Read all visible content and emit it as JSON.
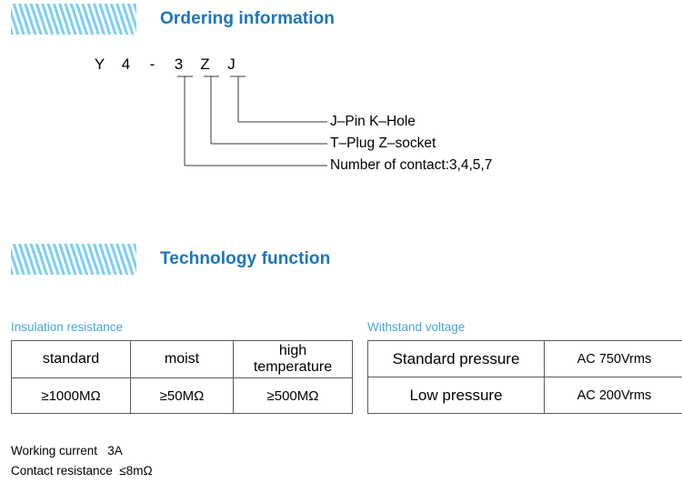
{
  "colors": {
    "heading_blue": "#1b75bc",
    "caption_blue": "#4aa3d8",
    "stripe_blue": "#7ecef4",
    "table_border": "#5a5a5a"
  },
  "sections": {
    "ordering": {
      "title": "Ordering information"
    },
    "technology": {
      "title": "Technology function"
    }
  },
  "ordering_code": {
    "characters": [
      "Y",
      "4",
      "-",
      "3",
      "Z",
      "J"
    ],
    "callouts": [
      {
        "label": "J–Pin  K–Hole"
      },
      {
        "label": "T–Plug  Z–socket"
      },
      {
        "label": "Number of contact:3,4,5,7"
      }
    ]
  },
  "insulation_resistance": {
    "caption": "Insulation resistance",
    "headers": [
      "standard",
      "moist",
      "high\ntemperature"
    ],
    "header_high_line1": "high",
    "header_high_line2": "temperature",
    "values": [
      "≥1000MΩ",
      "≥50MΩ",
      "≥500MΩ"
    ]
  },
  "withstand_voltage": {
    "caption": "Withstand voltage",
    "rows": [
      {
        "label": "Standard pressure",
        "value": "AC  750Vrms"
      },
      {
        "label": "Low pressure",
        "value": "AC  200Vrms"
      }
    ]
  },
  "footnotes": [
    "Working current   3A",
    "Contact resistance  ≤8mΩ"
  ]
}
